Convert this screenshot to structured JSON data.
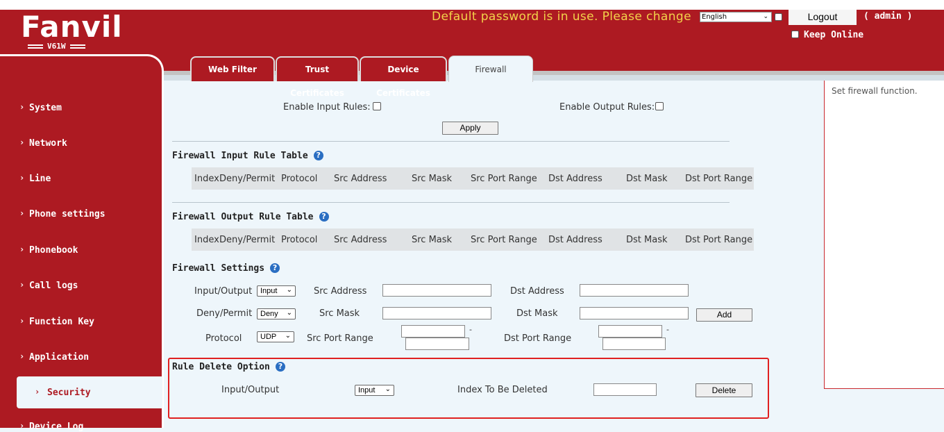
{
  "header": {
    "logo_text": "Fanvil",
    "model": "V61W",
    "warning": "Default password is in use. Please change",
    "language": "English",
    "logout_label": "Logout",
    "admin_label": "( admin )",
    "keep_online_label": "Keep Online"
  },
  "sidebar": {
    "items": [
      {
        "label": "System"
      },
      {
        "label": "Network"
      },
      {
        "label": "Line"
      },
      {
        "label": "Phone settings"
      },
      {
        "label": "Phonebook"
      },
      {
        "label": "Call logs"
      },
      {
        "label": "Function Key"
      },
      {
        "label": "Application"
      },
      {
        "label": "Security"
      },
      {
        "label": "Device Log"
      }
    ],
    "active": "Security"
  },
  "tabs": [
    {
      "label": "Web Filter"
    },
    {
      "label": "Trust Certificates"
    },
    {
      "label": "Device Certificates"
    },
    {
      "label": "Firewall"
    }
  ],
  "help_text": "Set firewall function.",
  "rules": {
    "enable_input_label": "Enable Input Rules:",
    "enable_output_label": "Enable Output Rules:",
    "apply_label": "Apply"
  },
  "input_table": {
    "title": "Firewall Input Rule Table",
    "columns": [
      "Index",
      "Deny/Permit",
      "Protocol",
      "Src Address",
      "Src Mask",
      "Src Port Range",
      "Dst Address",
      "Dst Mask",
      "Dst Port Range"
    ]
  },
  "output_table": {
    "title": "Firewall Output Rule Table",
    "columns": [
      "Index",
      "Deny/Permit",
      "Protocol",
      "Src Address",
      "Src Mask",
      "Src Port Range",
      "Dst Address",
      "Dst Mask",
      "Dst Port Range"
    ]
  },
  "settings": {
    "title": "Firewall Settings",
    "input_output_label": "Input/Output",
    "input_output_value": "Input",
    "src_address_label": "Src Address",
    "dst_address_label": "Dst Address",
    "deny_permit_label": "Deny/Permit",
    "deny_permit_value": "Deny",
    "src_mask_label": "Src Mask",
    "dst_mask_label": "Dst Mask",
    "add_label": "Add",
    "protocol_label": "Protocol",
    "protocol_value": "UDP",
    "src_port_label": "Src Port Range",
    "dst_port_label": "Dst Port Range",
    "range_dash": "-"
  },
  "delete": {
    "title": "Rule Delete Option",
    "input_output_label": "Input/Output",
    "input_output_value": "Input",
    "index_label": "Index To Be Deleted",
    "delete_label": "Delete"
  },
  "icons": {
    "chevron": "chevron-down-icon",
    "help": "help-icon",
    "nav_arrow": "chevron-right-icon"
  },
  "colors": {
    "brand_red": "#ad1a22",
    "warning_yellow": "#f2d24a",
    "highlight_red": "#e02020",
    "page_bg": "#eef6fb"
  }
}
